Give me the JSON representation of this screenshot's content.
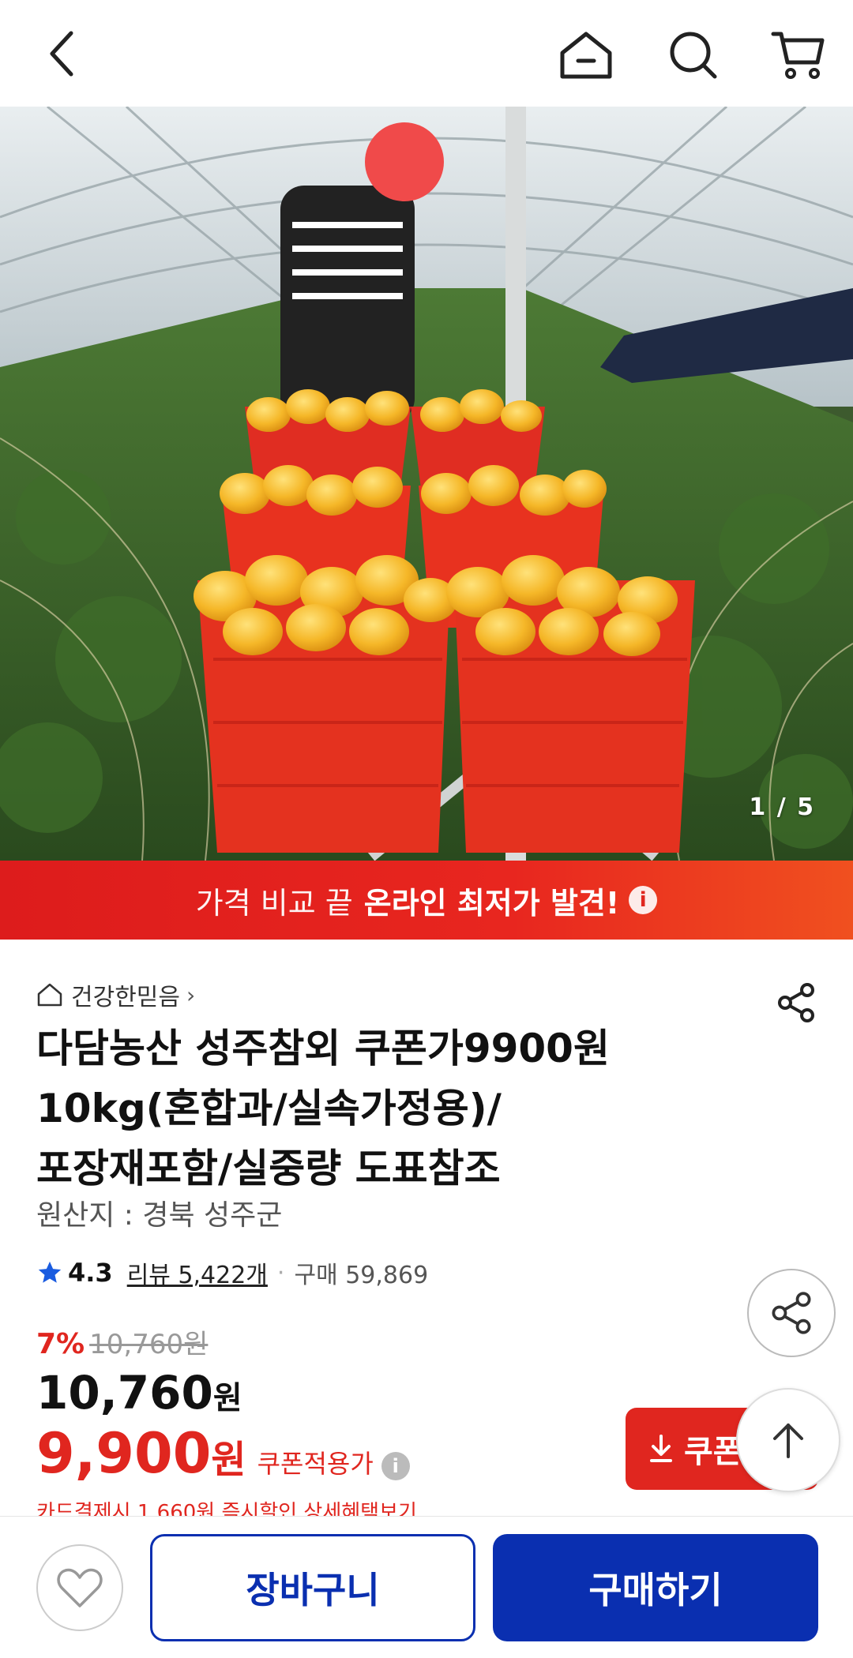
{
  "nav": {
    "back_icon": "chevron-left-icon",
    "home_icon": "home-icon",
    "search_icon": "search-icon",
    "cart_icon": "cart-icon"
  },
  "gallery": {
    "current": 1,
    "total": 5,
    "pager_text": "1 / 5"
  },
  "banner": {
    "light_text": "가격 비교 끝",
    "strong_text": "온라인 최저가 발견!",
    "info_icon": "i"
  },
  "product": {
    "store_name": "건강한믿음",
    "store_chevron": "›",
    "title_lines": [
      "다담농산 성주참외 쿠폰가9900원",
      "10kg(혼합과/실속가정용)/",
      "포장재포함/실중량 도표참조"
    ],
    "origin": "원산지 : 경북 성주군",
    "rating": "4.3",
    "reviews": "리뷰 5,422개",
    "dot": "·",
    "sold": "구매 59,869",
    "discount_pct": "7%",
    "original_price": "10,760원",
    "price": "10,760",
    "price_unit": "원",
    "coupon_price": "9,900",
    "coupon_unit": "원",
    "coupon_label": "쿠폰적용가",
    "coupon_info": "i",
    "coupon_button": "쿠폰받",
    "peek_text": "카드결제시 1,660원 즉시할인 상세혜택보기"
  },
  "bottom": {
    "cart_label": "장바구니",
    "buy_label": "구매하기"
  },
  "colors": {
    "accent_red": "#e0261f",
    "primary_blue": "#0a2fb0"
  }
}
